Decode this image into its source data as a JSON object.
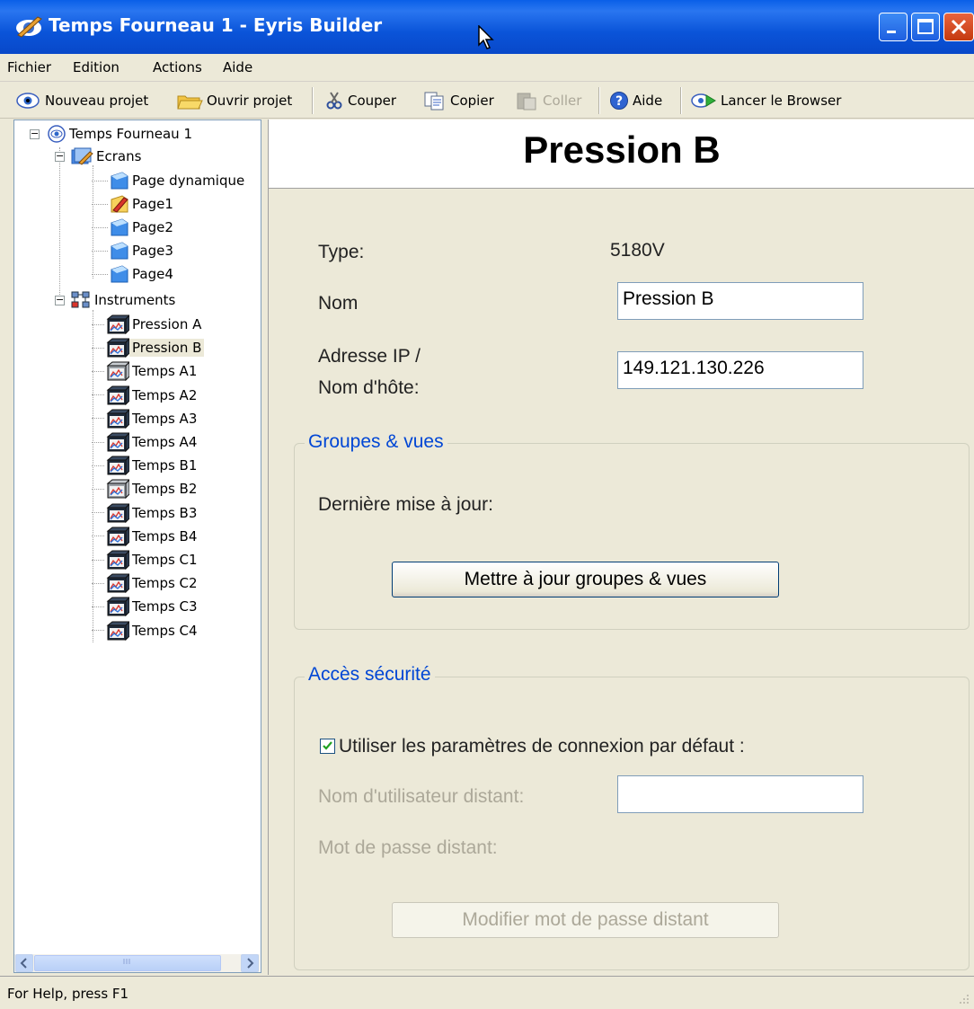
{
  "window": {
    "title": "Temps Fourneau 1 - Eyris Builder"
  },
  "menu": [
    "Fichier",
    "Edition",
    "Actions",
    "Aide"
  ],
  "toolbar": {
    "new_project": "Nouveau projet",
    "open_project": "Ouvrir projet",
    "cut": "Couper",
    "copy": "Copier",
    "paste": "Coller",
    "help": "Aide",
    "launch_browser": "Lancer le Browser"
  },
  "tree": {
    "root": "Temps Fourneau 1",
    "screens_label": "Ecrans",
    "screens": [
      "Page dynamique",
      "Page1",
      "Page2",
      "Page3",
      "Page4"
    ],
    "instruments_label": "Instruments",
    "instruments": [
      "Pression A",
      "Pression B",
      "Temps A1",
      "Temps A2",
      "Temps A3",
      "Temps A4",
      "Temps B1",
      "Temps B2",
      "Temps B3",
      "Temps B4",
      "Temps C1",
      "Temps C2",
      "Temps C3",
      "Temps C4"
    ],
    "selected": "Pression B"
  },
  "panel": {
    "title": "Pression B",
    "type_label": "Type:",
    "type_value": "5180V",
    "name_label": "Nom",
    "name_value": "Pression B",
    "address_label_line1": "Adresse IP /",
    "address_label_line2": "Nom d'hôte:",
    "address_value": "149.121.130.226",
    "groups_legend": "Groupes & vues",
    "last_update_label": "Dernière mise à jour:",
    "update_button": "Mettre à jour groupes & vues",
    "security_legend": "Accès sécurité",
    "default_connection_label": "Utiliser les paramètres de connexion par défaut :",
    "default_connection_checked": true,
    "remote_user_label": "Nom d'utilisateur distant:",
    "remote_user_value": "",
    "remote_password_label": "Mot de passe distant:",
    "modify_password_button": "Modifier mot de passe distant"
  },
  "status": {
    "text": "For Help, press F1"
  }
}
